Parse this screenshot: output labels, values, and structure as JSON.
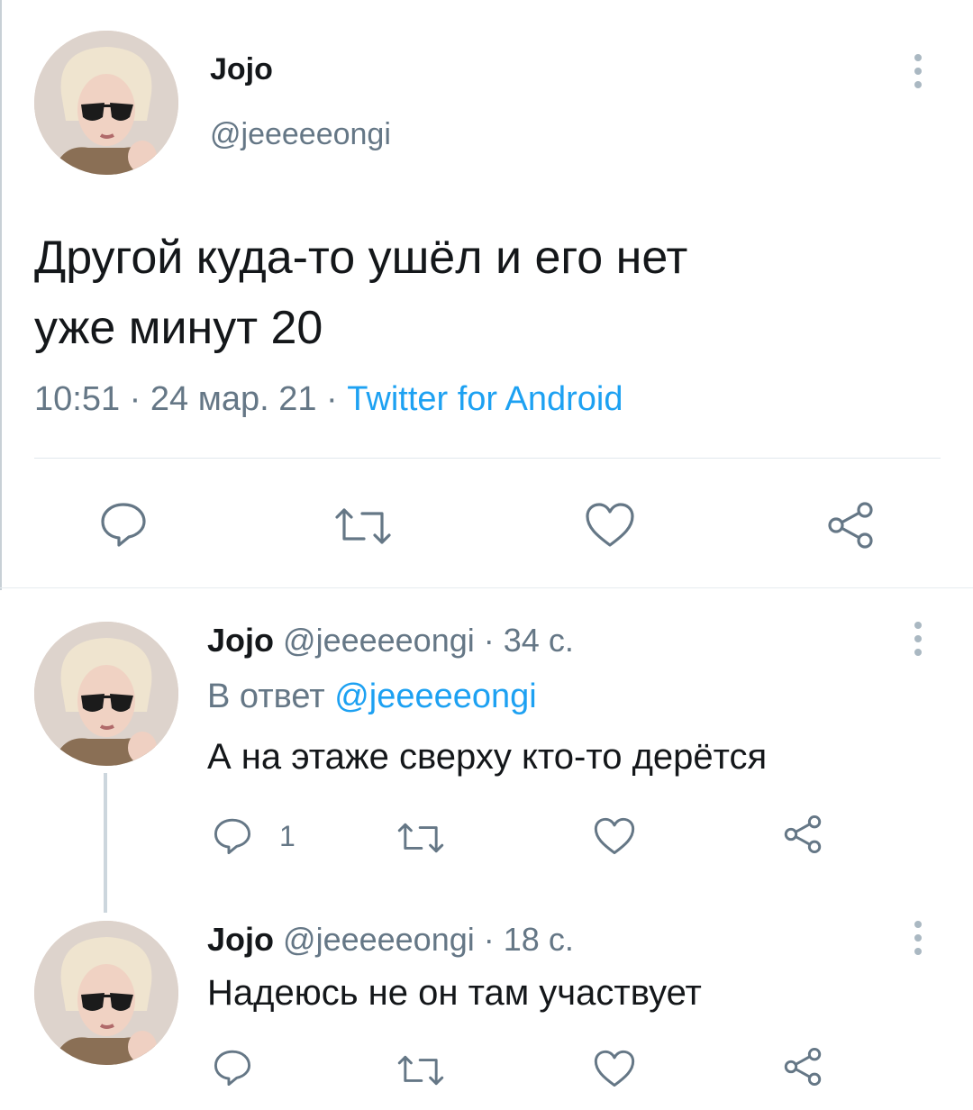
{
  "main_tweet": {
    "display_name": "Jojo",
    "handle": "@jeeeeeongi",
    "text_line1": "Другой куда-то ушёл и его нет",
    "text_line2": "уже минут 20",
    "time": "10:51",
    "sep1": "·",
    "date": "24 мар. 21",
    "sep2": "·",
    "client": "Twitter for Android"
  },
  "reply1": {
    "display_name": "Jojo",
    "handle": "@jeeeeeongi",
    "sep": "·",
    "age": "34 с.",
    "reply_prefix": "В ответ",
    "reply_to": "@jeeeeeongi",
    "text": "А на этаже сверху кто-то дерётся",
    "reply_count": "1"
  },
  "reply2": {
    "display_name": "Jojo",
    "handle": "@jeeeeeongi",
    "sep": "·",
    "age": "18 с.",
    "text": "Надеюсь не он там участвует"
  },
  "icons": [
    "reply-icon",
    "retweet-icon",
    "like-icon",
    "share-icon",
    "more-icon"
  ],
  "colors": {
    "accent": "#1da1f2",
    "secondary_text": "#657786",
    "icon": "#657786",
    "divider": "#e1e8ed"
  }
}
